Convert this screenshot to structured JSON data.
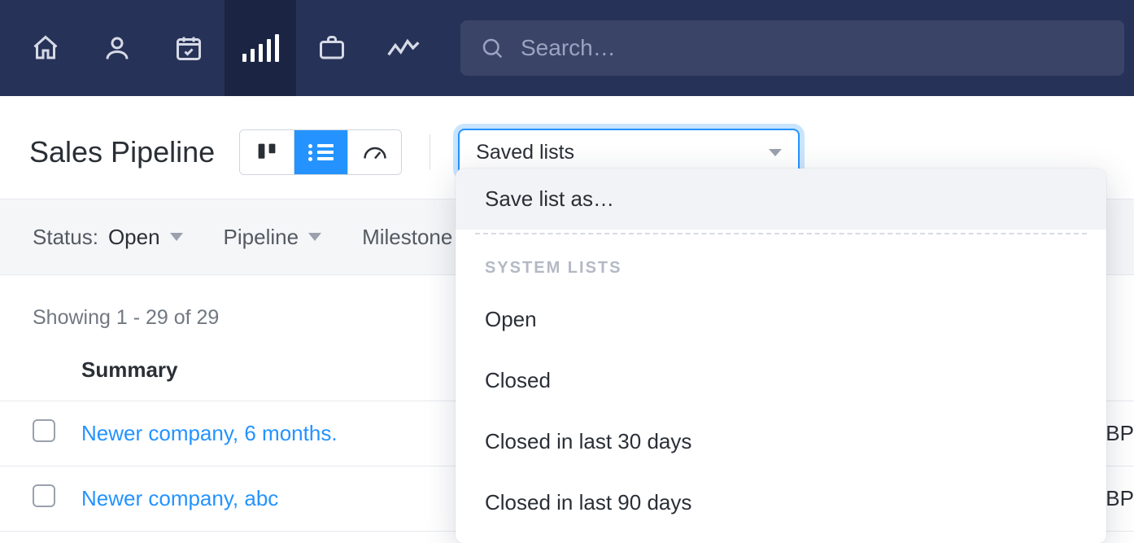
{
  "nav_icons": [
    "home",
    "person",
    "calendar",
    "pipeline",
    "case",
    "trend"
  ],
  "nav_active": "pipeline",
  "search": {
    "placeholder": "Search…"
  },
  "page_title": "Sales Pipeline",
  "view_modes": [
    "board",
    "list",
    "dashboard"
  ],
  "view_active": "list",
  "saved_lists": {
    "label": "Saved lists",
    "save_as": "Save list as…",
    "section_heading": "SYSTEM LISTS",
    "items": [
      "Open",
      "Closed",
      "Closed in last 30 days",
      "Closed in last 90 days"
    ]
  },
  "filters": {
    "status_label": "Status: ",
    "status_value": "Open",
    "pipeline_label": "Pipeline",
    "milestone_label": "Milestone"
  },
  "showing_text": "Showing 1 - 29 of 29",
  "columns": {
    "summary": "Summary"
  },
  "currency_fragment": "GBP",
  "rows": [
    {
      "summary": "Newer company, 6 months.",
      "currency": "GBP"
    },
    {
      "summary": "Newer company, abc",
      "currency": "GBP"
    }
  ]
}
